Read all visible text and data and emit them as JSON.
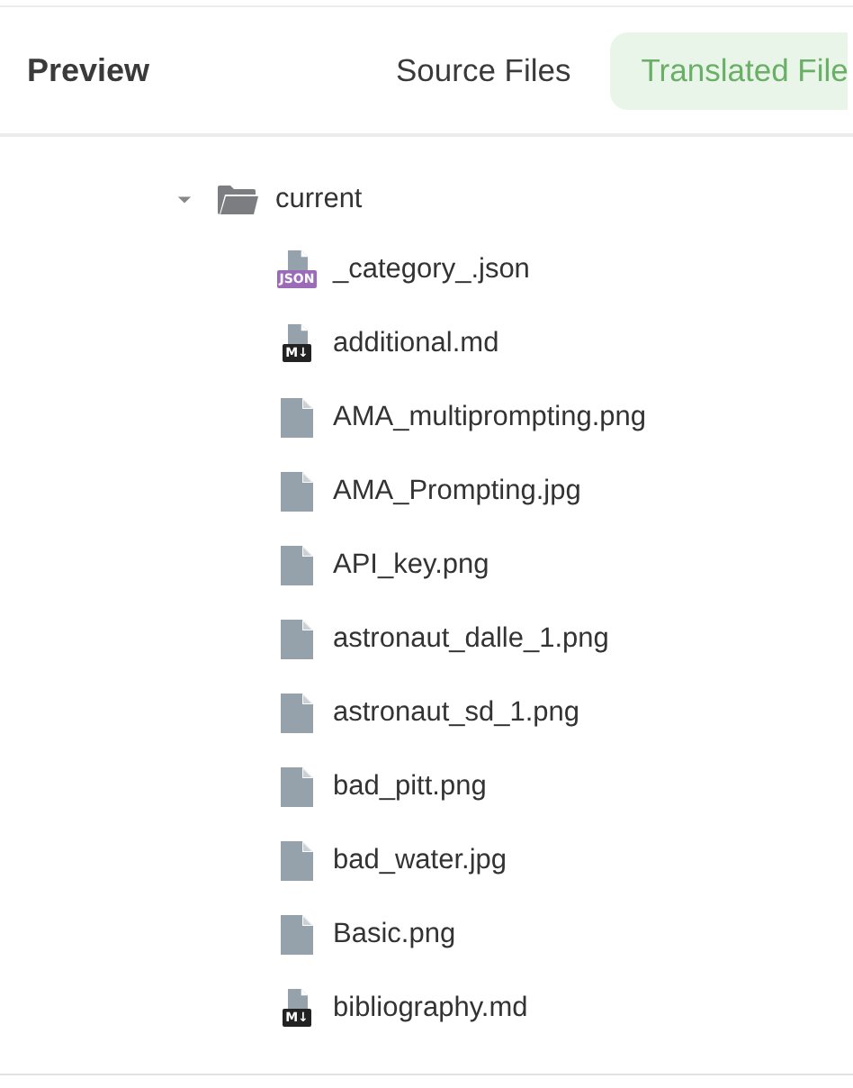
{
  "header": {
    "title": "Preview",
    "tabs": [
      {
        "label": "Source Files",
        "selected": false
      },
      {
        "label": "Translated File",
        "selected": true
      }
    ]
  },
  "tree": {
    "folder": {
      "name": "current",
      "expanded": true,
      "children": [
        {
          "name": "_category_.json",
          "kind": "json",
          "badge": "JSON"
        },
        {
          "name": "additional.md",
          "kind": "markdown",
          "badge": "M↓"
        },
        {
          "name": "AMA_multiprompting.png",
          "kind": "file"
        },
        {
          "name": "AMA_Prompting.jpg",
          "kind": "file"
        },
        {
          "name": "API_key.png",
          "kind": "file"
        },
        {
          "name": "astronaut_dalle_1.png",
          "kind": "file"
        },
        {
          "name": "astronaut_sd_1.png",
          "kind": "file"
        },
        {
          "name": "bad_pitt.png",
          "kind": "file"
        },
        {
          "name": "bad_water.jpg",
          "kind": "file"
        },
        {
          "name": "Basic.png",
          "kind": "file"
        },
        {
          "name": "bibliography.md",
          "kind": "markdown",
          "badge": "M↓"
        }
      ]
    }
  }
}
